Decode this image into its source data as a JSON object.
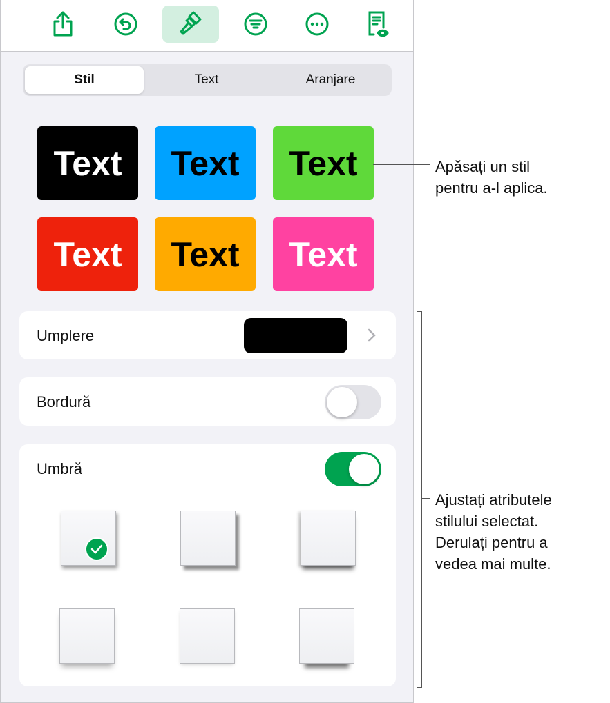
{
  "toolbar": {
    "items": [
      {
        "icon": "share-icon"
      },
      {
        "icon": "undo-icon"
      },
      {
        "icon": "format-brush-icon",
        "active": true
      },
      {
        "icon": "filter-icon"
      },
      {
        "icon": "more-icon"
      },
      {
        "icon": "document-view-icon"
      }
    ],
    "accent": "#00a350"
  },
  "tabs": [
    {
      "label": "Stil",
      "selected": true
    },
    {
      "label": "Text"
    },
    {
      "label": "Aranjare"
    }
  ],
  "styles": [
    {
      "label": "Text",
      "bg": "#000000",
      "fg": "#ffffff"
    },
    {
      "label": "Text",
      "bg": "#00a2ff",
      "fg": "#000000"
    },
    {
      "label": "Text",
      "bg": "#5fd93a",
      "fg": "#000000"
    },
    {
      "label": "Text",
      "bg": "#ee220c",
      "fg": "#ffffff"
    },
    {
      "label": "Text",
      "bg": "#ffaa00",
      "fg": "#000000"
    },
    {
      "label": "Text",
      "bg": "#ff42a1",
      "fg": "#ffffff"
    }
  ],
  "fill": {
    "label": "Umplere",
    "color": "#000000"
  },
  "border": {
    "label": "Bordură",
    "on": false
  },
  "shadow": {
    "label": "Umbră",
    "on": true,
    "selected_index": 0
  },
  "annotations": {
    "style": "Apăsați un stil\npentru a-l aplica.",
    "attributes": "Ajustați atributele\nstilului selectat.\nDerulați pentru a\nvedea mai multe."
  }
}
